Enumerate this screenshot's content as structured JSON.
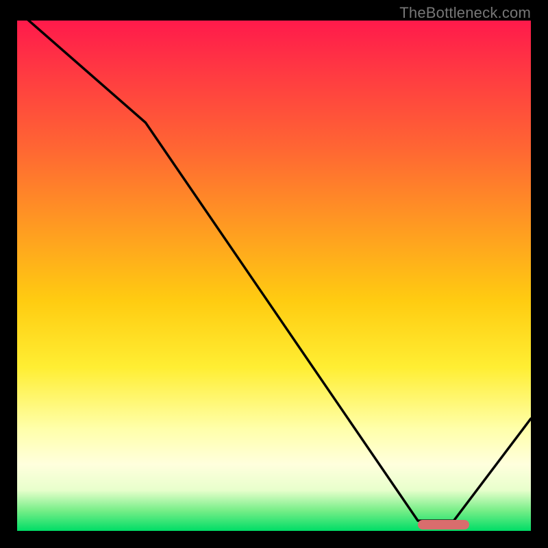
{
  "watermark": "TheBottleneck.com",
  "chart_data": {
    "type": "line",
    "title": "",
    "xlabel": "",
    "ylabel": "",
    "xlim": [
      0,
      100
    ],
    "ylim": [
      0,
      100
    ],
    "series": [
      {
        "name": "curve",
        "x": [
          0,
          25,
          78,
          85,
          100
        ],
        "values": [
          102,
          80,
          2,
          2,
          22
        ]
      }
    ],
    "marker": {
      "x_start": 78,
      "x_end": 88,
      "y": 1.2
    },
    "gradient_stops": [
      {
        "pct": 0,
        "color": "#ff1a4b"
      },
      {
        "pct": 25,
        "color": "#ff6633"
      },
      {
        "pct": 55,
        "color": "#ffcc11"
      },
      {
        "pct": 80,
        "color": "#ffffaa"
      },
      {
        "pct": 96,
        "color": "#77ee88"
      },
      {
        "pct": 100,
        "color": "#00dd66"
      }
    ]
  }
}
